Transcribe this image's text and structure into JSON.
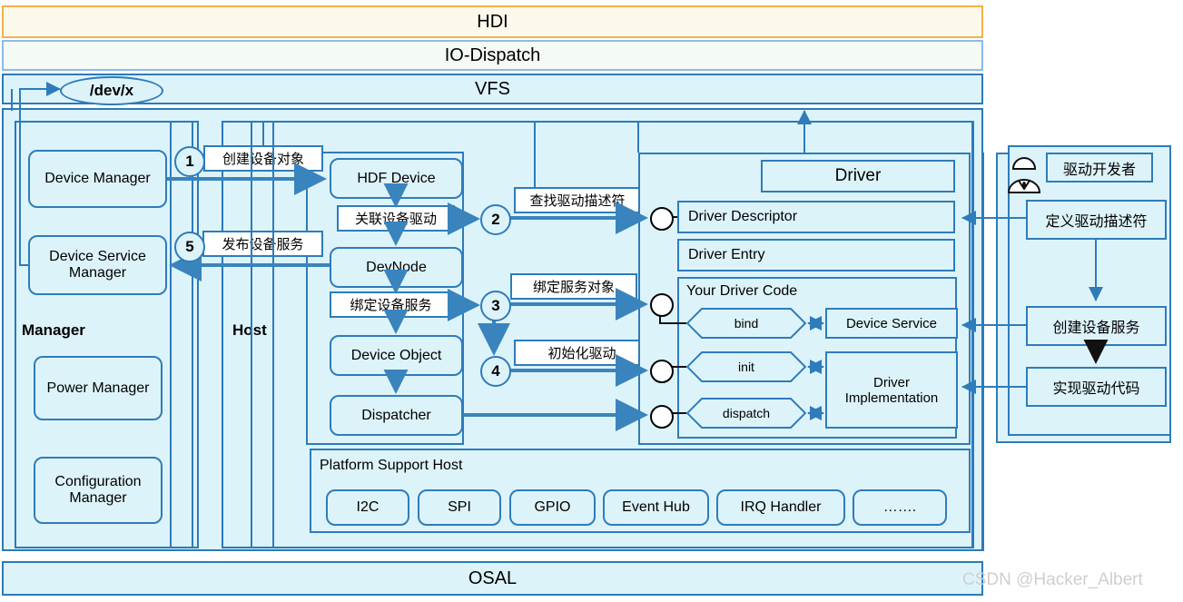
{
  "layers": {
    "hdi": "HDI",
    "io_dispatch": "IO-Dispatch",
    "vfs": "VFS",
    "osal": "OSAL",
    "devnode_path": "/dev/x"
  },
  "manager": {
    "section_label": "Manager",
    "device_manager": "Device Manager",
    "device_service_manager": "Device Service Manager",
    "power_manager": "Power Manager",
    "configuration_manager": "Configuration Manager"
  },
  "host": {
    "section_label": "Host",
    "hdf_device": "HDF Device",
    "devnode": "DevNode",
    "device_object": "Device Object",
    "dispatcher": "Dispatcher"
  },
  "steps": [
    {
      "num": "1",
      "label": "创建设备对象"
    },
    {
      "num": "2",
      "label": "关联设备驱动"
    },
    {
      "num": "3",
      "label": "绑定设备服务"
    },
    {
      "num": "4",
      "label": "初始化驱动"
    },
    {
      "num": "5",
      "label": "发布设备服务"
    }
  ],
  "step_right_labels": {
    "find_descriptor": "查找驱动描述符",
    "bind_service_object": "绑定服务对象",
    "init_driver": "初始化驱动"
  },
  "driver": {
    "title": "Driver",
    "descriptor": "Driver Descriptor",
    "entry": "Driver Entry",
    "your_code": "Your Driver Code",
    "bind": "bind",
    "init": "init",
    "dispatch": "dispatch",
    "device_service": "Device Service",
    "driver_implementation": "Driver Implementation"
  },
  "platform": {
    "title": "Platform Support Host",
    "items": [
      "I2C",
      "SPI",
      "GPIO",
      "Event Hub",
      "IRQ Handler",
      "……."
    ]
  },
  "developer": {
    "role": "驱动开发者",
    "actor_icon": "user-actor-icon",
    "steps": [
      "定义驱动描述符",
      "创建设备服务",
      "实现驱动代码"
    ]
  },
  "watermark": "CSDN @Hacker_Albert",
  "colors": {
    "accent": "#2e7cba",
    "fill": "#ddf3fa",
    "hdi_border": "#f0b24a",
    "hdi_fill": "#fdf8ec",
    "iod_border": "#8cbbe5",
    "iod_fill": "#f4faf4"
  }
}
